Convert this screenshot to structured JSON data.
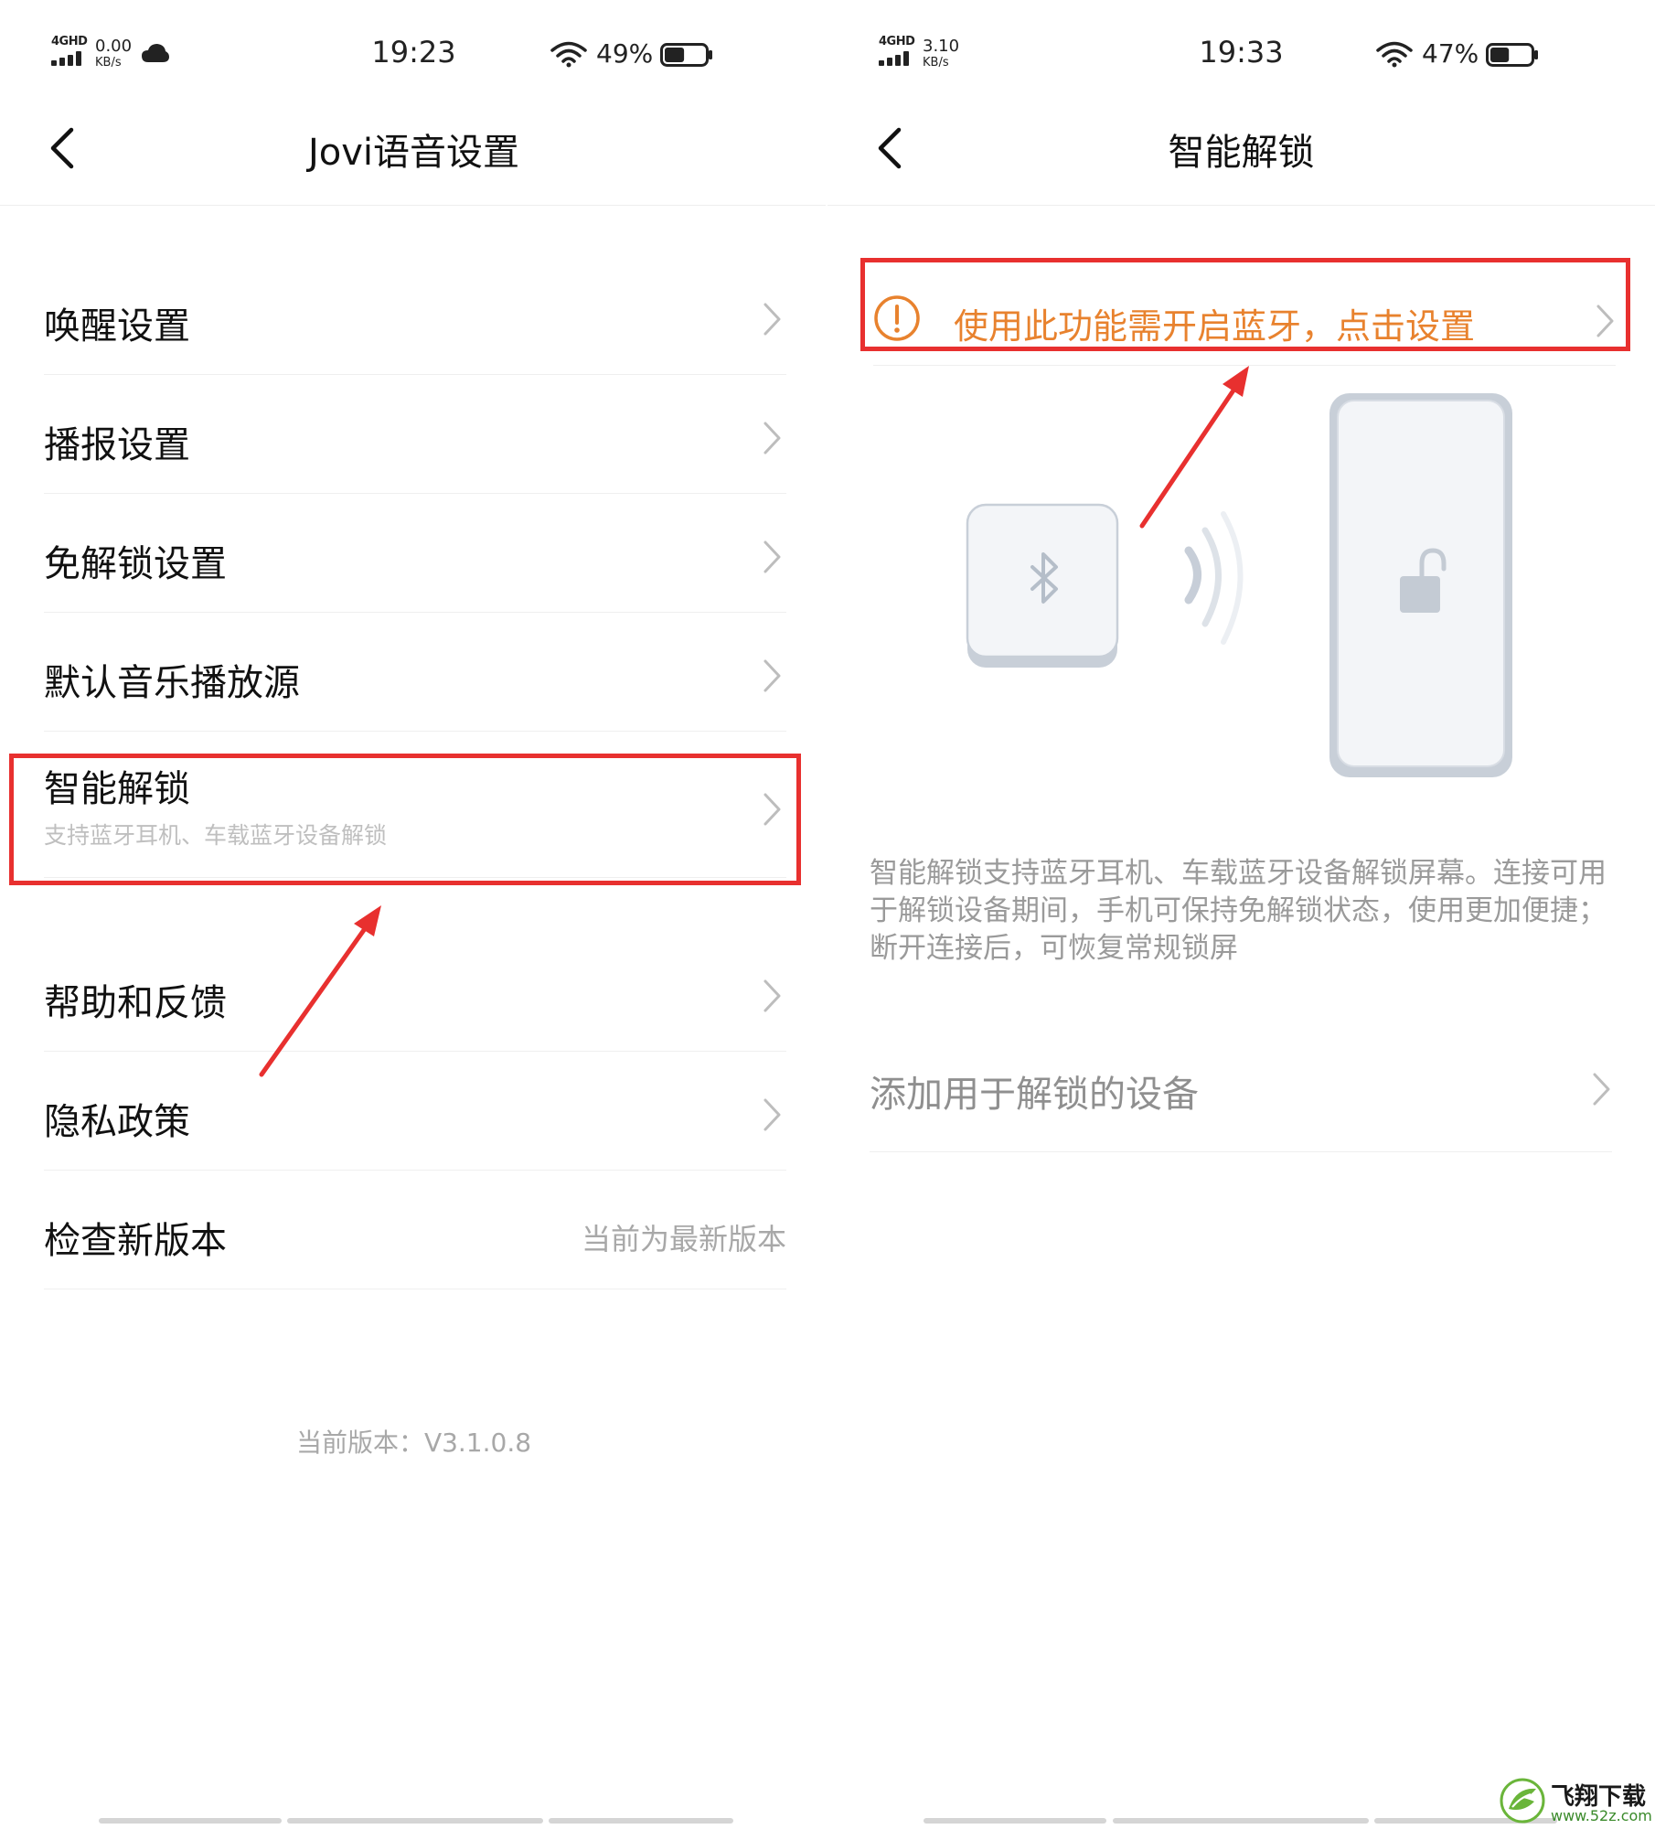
{
  "left": {
    "status_bar": {
      "network": "4GHD",
      "speed_value": "0.00",
      "speed_unit": "KB/s",
      "time": "19:23",
      "battery_percent": "49%",
      "battery_level": 0.49
    },
    "title": "Jovi语音设置",
    "items": [
      {
        "label": "唤醒设置"
      },
      {
        "label": "播报设置"
      },
      {
        "label": "免解锁设置"
      },
      {
        "label": "默认音乐播放源"
      },
      {
        "label": "智能解锁",
        "sub": "支持蓝牙耳机、车载蓝牙设备解锁"
      },
      {
        "label": "帮助和反馈"
      },
      {
        "label": "隐私政策"
      },
      {
        "label": "检查新版本",
        "value": "当前为最新版本"
      }
    ],
    "version_text": "当前版本：V3.1.0.8"
  },
  "right": {
    "status_bar": {
      "network": "4GHD",
      "speed_value": "3.10",
      "speed_unit": "KB/s",
      "time": "19:33",
      "battery_percent": "47%",
      "battery_level": 0.47
    },
    "title": "智能解锁",
    "bluetooth_tip": "使用此功能需开启蓝牙，点击设置",
    "description": "智能解锁支持蓝牙耳机、车载蓝牙设备解锁屏幕。连接可用于解锁设备期间，手机可保持免解锁状态，使用更加便捷；断开连接后，可恢复常规锁屏",
    "add_device_label": "添加用于解锁的设备"
  },
  "watermark": {
    "name": "飞翔下载",
    "url": "www.52z.com"
  },
  "colors": {
    "highlight": "#e8302f",
    "warning": "#e8822e",
    "secondary_text": "#a8a8a8"
  },
  "icons": [
    "back-arrow-icon",
    "chevron-right-icon",
    "wifi-icon",
    "battery-icon",
    "cloud-icon",
    "signal-icon",
    "warning-circle-icon",
    "bluetooth-icon",
    "unlock-icon"
  ]
}
